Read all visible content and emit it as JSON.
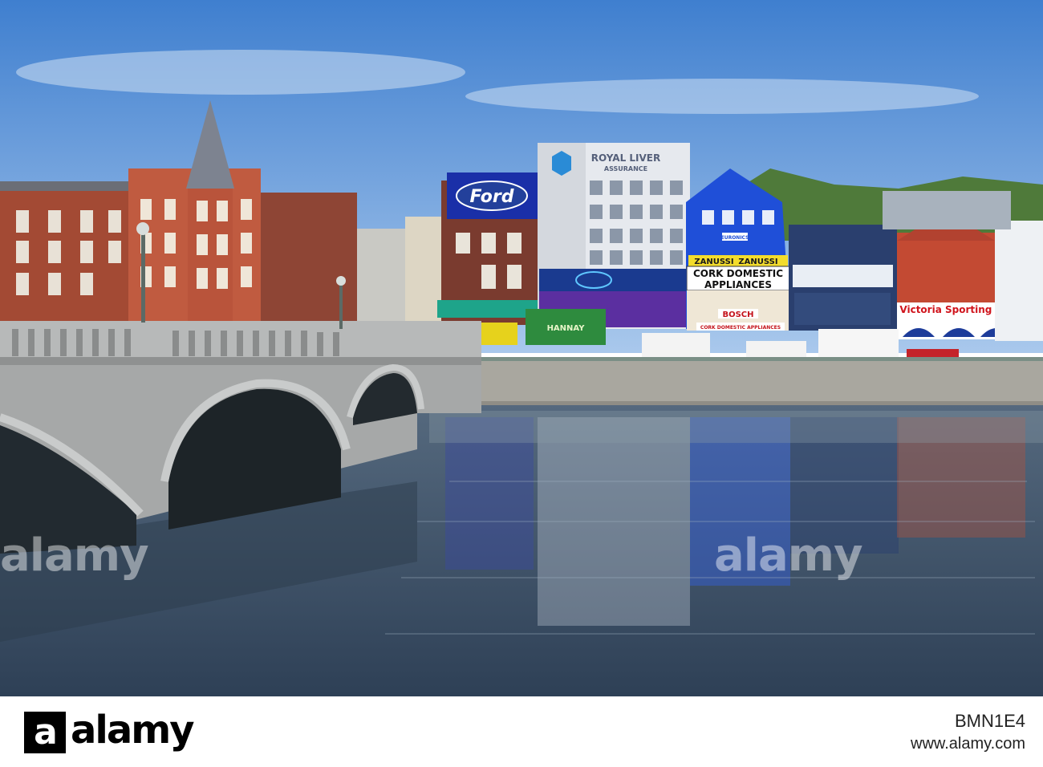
{
  "signs": {
    "ford": "Ford",
    "royal_liver": "ROYAL LIVER",
    "assurance": "ASSURANCE",
    "zanussi_1": "ZANUSSI",
    "zanussi_2": "ZANUSSI",
    "cork_domestic_1": "CORK DOMESTIC",
    "appliances": "APPLIANCES",
    "bosch": "BOSCH",
    "cork_domestic_2": "CORK DOMESTIC APPLIANCES",
    "victoria": "Victoria Sporting Club",
    "hannah": "HANNAY",
    "euronics": "EURONICS"
  },
  "watermark": {
    "text": "alamy"
  },
  "footer": {
    "logo": "alamy",
    "image_id": "BMN1E4",
    "url": "www.alamy.com"
  },
  "colors": {
    "sky_top": "#3f7fcf",
    "sky_bottom": "#a9c8ec",
    "water": "#3b5068",
    "brick": "#b5533b",
    "ford_blue": "#1a2fa8",
    "blue_building": "#1f4fd8"
  }
}
